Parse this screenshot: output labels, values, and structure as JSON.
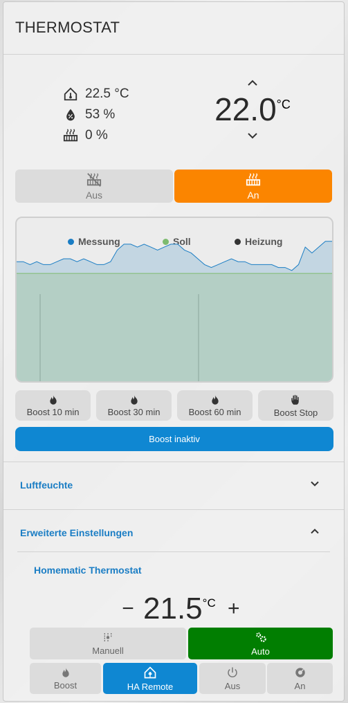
{
  "title": "THERMOSTAT",
  "readings": {
    "temperature": "22.5 °C",
    "humidity": "53 %",
    "heating": "0 %"
  },
  "setpoint": {
    "value": "22.0",
    "unit": "°C"
  },
  "mode": {
    "off_label": "Aus",
    "on_label": "An",
    "active": "An",
    "active_color": "#fb8500"
  },
  "chart_data": {
    "type": "area",
    "title": "",
    "series": [
      {
        "name": "Messung",
        "color": "#1a7dc4",
        "values": [
          22.1,
          22.1,
          22.0,
          22.1,
          22.0,
          22.0,
          22.1,
          22.2,
          22.2,
          22.1,
          22.2,
          22.1,
          22.0,
          22.0,
          22.1,
          22.5,
          22.7,
          22.7,
          22.6,
          22.7,
          22.6,
          22.5,
          22.6,
          22.7,
          22.7,
          22.5,
          22.4,
          22.2,
          22.0,
          21.9,
          22.0,
          22.1,
          22.2,
          22.1,
          22.1,
          22.0,
          22.0,
          22.0,
          22.0,
          21.9,
          21.9,
          21.8,
          22.0,
          22.6,
          22.4,
          22.6,
          22.8,
          22.8
        ]
      },
      {
        "name": "Soll",
        "color": "#7dbb6f",
        "values": [
          21.7,
          21.7
        ]
      },
      {
        "name": "Heizung",
        "color": "#333333",
        "values": [
          0,
          0
        ]
      }
    ],
    "ylim": [
      18.0,
      23.6
    ],
    "grid": false,
    "legend": "top"
  },
  "boost": {
    "buttons": [
      "Boost 10 min",
      "Boost 30 min",
      "Boost 60 min",
      "Boost Stop"
    ],
    "status": "Boost inaktiv"
  },
  "sections": {
    "humidity": "Luftfeuchte",
    "advanced": "Erweiterte Einstellungen"
  },
  "homematic": {
    "title": "Homematic Thermostat",
    "minus": "−",
    "plus": "+",
    "value": "21.5",
    "unit": "°C",
    "manual_label": "Manuell",
    "auto_label": "Auto",
    "auto_color": "#017e01",
    "boost_label": "Boost",
    "remote_label": "HA Remote",
    "remote_color": "#0f87d2",
    "off_label": "Aus",
    "on_label": "An"
  }
}
